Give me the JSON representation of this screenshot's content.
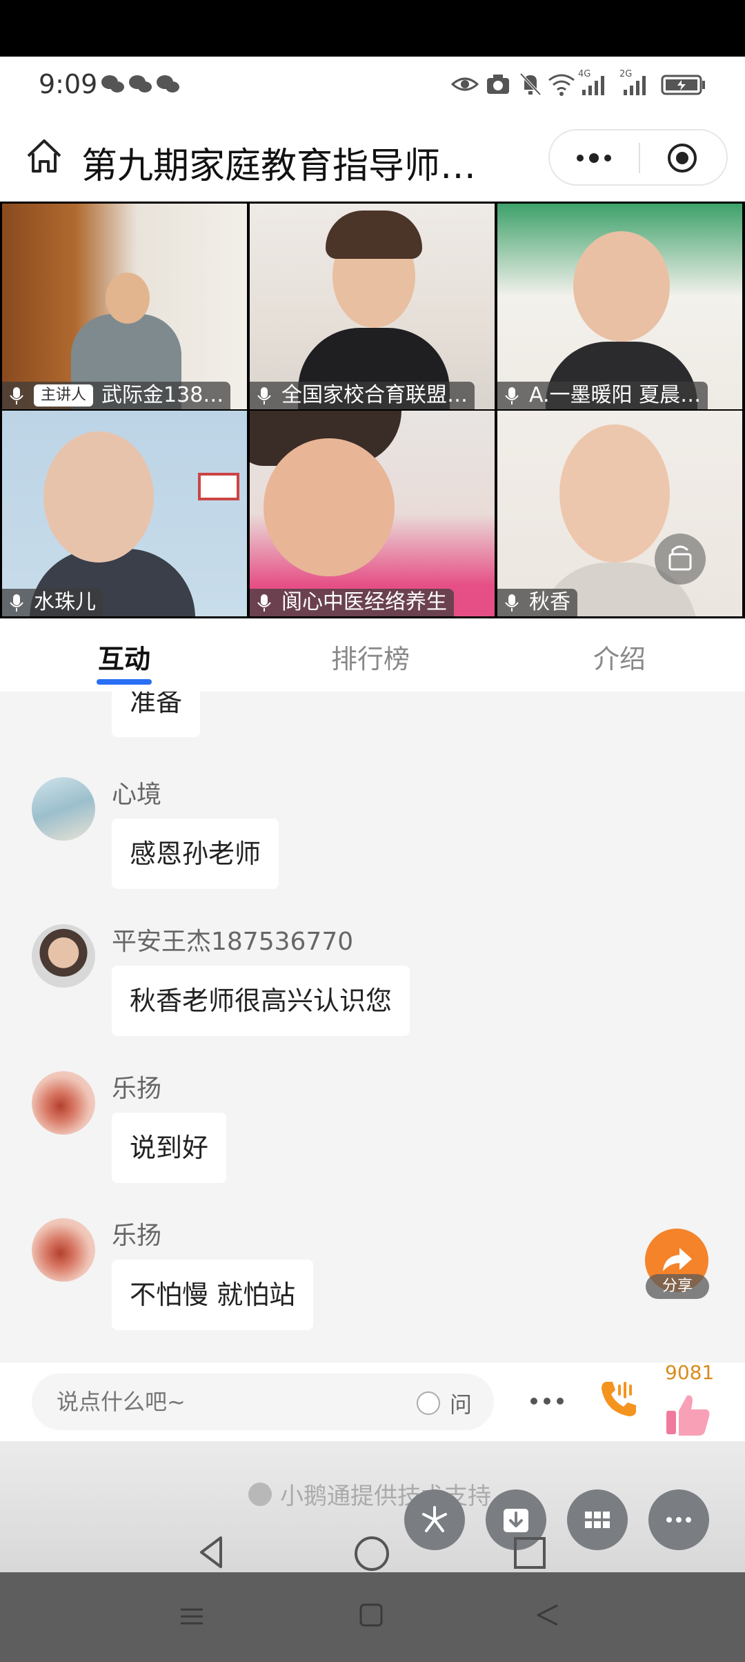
{
  "status_bar": {
    "time": "9:09",
    "network_1": "4G",
    "network_2": "2G"
  },
  "title_bar": {
    "title": "第九期家庭教育指导师…"
  },
  "video_tiles": [
    {
      "name": "武际金138…",
      "host_badge": "主讲人"
    },
    {
      "name": "全国家校合育联盟…"
    },
    {
      "name": "A.一墨暖阳 夏晨…"
    },
    {
      "name": "水珠儿"
    },
    {
      "name": "阆心中医经络养生"
    },
    {
      "name": "秋香"
    }
  ],
  "tabs": [
    {
      "label": "互动",
      "active": true
    },
    {
      "label": "排行榜",
      "active": false
    },
    {
      "label": "介绍",
      "active": false
    }
  ],
  "messages": [
    {
      "sender": "",
      "text": "准备"
    },
    {
      "sender": "心境",
      "text": "感恩孙老师"
    },
    {
      "sender": "平安王杰187536770",
      "text": "秋香老师很高兴认识您"
    },
    {
      "sender": "乐扬",
      "text": "说到好"
    },
    {
      "sender": "乐扬",
      "text": "不怕慢 就怕站"
    }
  ],
  "share_label": "分享",
  "input": {
    "placeholder": "说点什么吧~",
    "ask_label": "问"
  },
  "like_count": "9081",
  "powered_by": "小鹅通提供技术支持",
  "colors": {
    "accent": "#2a6ef5",
    "share": "#f5832a",
    "like_count": "#d98b1d"
  }
}
